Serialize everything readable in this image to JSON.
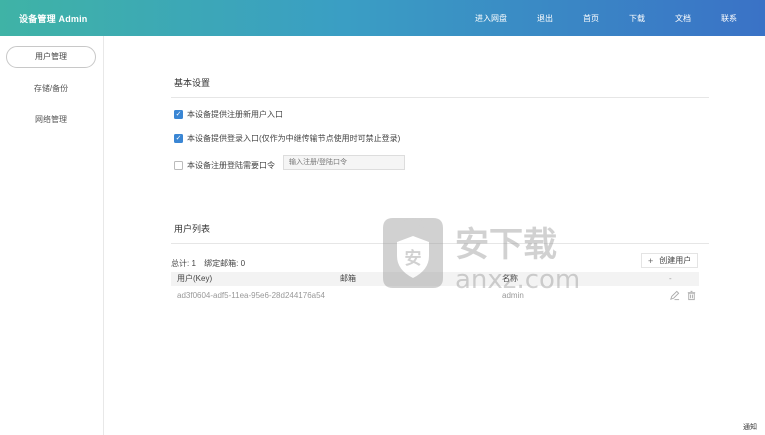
{
  "header": {
    "brand": "设备管理 Admin",
    "nav": [
      "进入网盘",
      "退出",
      "首页",
      "下载",
      "文档",
      "联系"
    ]
  },
  "sidebar": {
    "items": [
      {
        "label": "用户管理",
        "active": true
      },
      {
        "label": "存储/备份",
        "active": false
      },
      {
        "label": "网络管理",
        "active": false
      }
    ]
  },
  "basic_settings": {
    "title": "基本设置",
    "options": [
      {
        "label": "本设备提供注册新用户入口",
        "checked": true
      },
      {
        "label": "本设备提供登录入口(仅作为中继传输节点使用时可禁止登录)",
        "checked": true
      },
      {
        "label": "本设备注册登陆需要口令",
        "checked": false
      }
    ],
    "code_placeholder": "输入注册/登陆口令"
  },
  "user_list": {
    "title": "用户列表",
    "total_label": "总计: 1",
    "bound_label": "绑定邮箱: 0",
    "create_button": "创建用户",
    "columns": [
      "用户(Key)",
      "邮箱",
      "名称",
      "-"
    ],
    "rows": [
      {
        "key": "ad3f0604-adf5-11ea-95e6-28d244176a54",
        "email": "",
        "name": "admin"
      }
    ]
  },
  "watermark": {
    "brand_cn": "安下载",
    "domain": "anxz.com"
  },
  "footer": {
    "notice": "通知"
  },
  "colors": {
    "header_start": "#3fb3a6",
    "header_end": "#3a72c6",
    "checkbox_on": "#3a86d4"
  }
}
